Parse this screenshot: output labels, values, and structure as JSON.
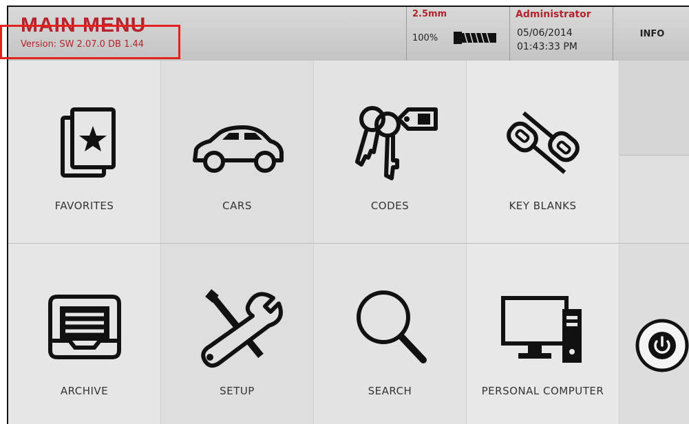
{
  "header": {
    "title": "MAIN MENU",
    "version": "Version: SW 2.07.0 DB 1.44",
    "blade_size": "2.5mm",
    "battery_percent": "100%",
    "user": "Administrator",
    "date": "05/06/2014",
    "time": "01:43:33 PM",
    "info_label": "INFO"
  },
  "menu": {
    "items": [
      {
        "label": "FAVORITES",
        "icon": "favorites-icon"
      },
      {
        "label": "CARS",
        "icon": "car-icon"
      },
      {
        "label": "CODES",
        "icon": "keys-tag-icon"
      },
      {
        "label": "KEY BLANKS",
        "icon": "key-blanks-icon"
      },
      {
        "label": "ARCHIVE",
        "icon": "archive-tray-icon"
      },
      {
        "label": "SETUP",
        "icon": "tools-icon"
      },
      {
        "label": "SEARCH",
        "icon": "magnifier-icon"
      },
      {
        "label": "PERSONAL COMPUTER",
        "icon": "computer-icon"
      }
    ]
  },
  "side": {
    "power_icon": "power-icon"
  },
  "colors": {
    "accent_red": "#b3242c",
    "highlight_red": "#e3211f"
  }
}
